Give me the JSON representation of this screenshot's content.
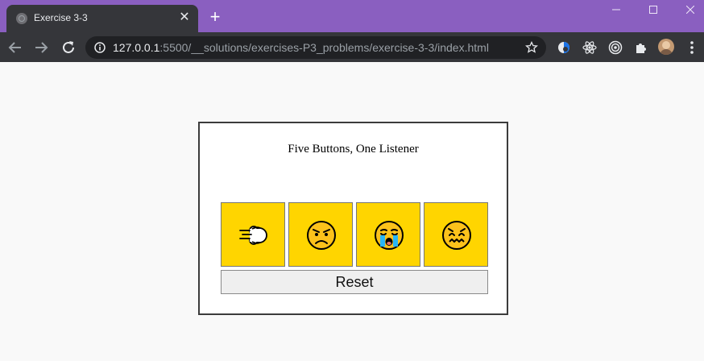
{
  "browser": {
    "tab_title": "Exercise 3-3",
    "close_glyph": "✕",
    "new_tab_glyph": "+",
    "url_host": "127.0.0.1",
    "url_rest": ":5500/__solutions/exercises-P3_problems/exercise-3-3/index.html",
    "chrome_color": "#8a5fc0",
    "toolbar_color": "#35363a"
  },
  "page": {
    "title": "Five Buttons, One Listener",
    "buttons": [
      {
        "icon": "dashing-away-icon",
        "color": "#ffd500"
      },
      {
        "icon": "angry-face-icon",
        "color": "#ffd500"
      },
      {
        "icon": "loudly-crying-face-icon",
        "color": "#ffd500"
      },
      {
        "icon": "confounded-face-icon",
        "color": "#ffd500"
      }
    ],
    "reset_label": "Reset"
  }
}
